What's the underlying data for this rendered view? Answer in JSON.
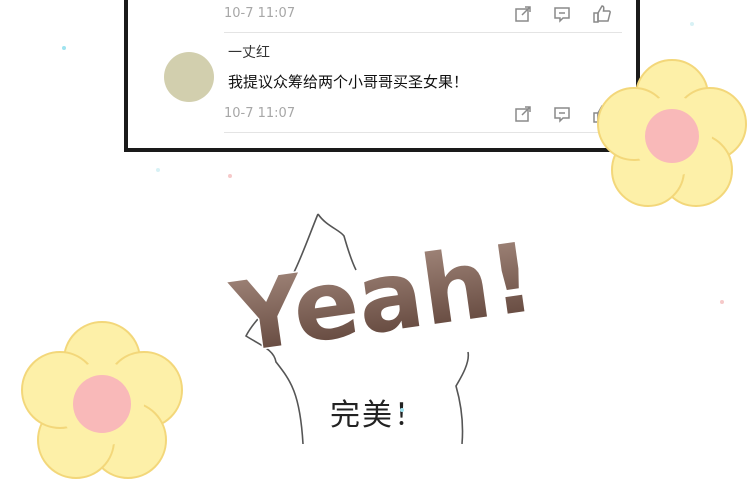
{
  "comments": [
    {
      "time": "10-7 11:07"
    },
    {
      "username": "一丈红",
      "text": "我提议众筹给两个小哥哥买圣女果！",
      "time": "10-7 11:07"
    }
  ],
  "icons": {
    "share": "share-icon",
    "reply": "comment-icon",
    "like": "thumbs-up-icon"
  },
  "panel_ink": {
    "username": "一丈红",
    "time": "10-7 11:07"
  },
  "art": {
    "shout": "Yeah!",
    "bubble_text": "完美！"
  },
  "colors": {
    "flower_petal": "#fdf0a8",
    "flower_outline": "#f3d77a",
    "flower_center": "#f9b9b9",
    "ink": "#1a1a1a",
    "shout_gradient_top": "#a78c80",
    "shout_gradient_bottom": "#5a3e34"
  }
}
